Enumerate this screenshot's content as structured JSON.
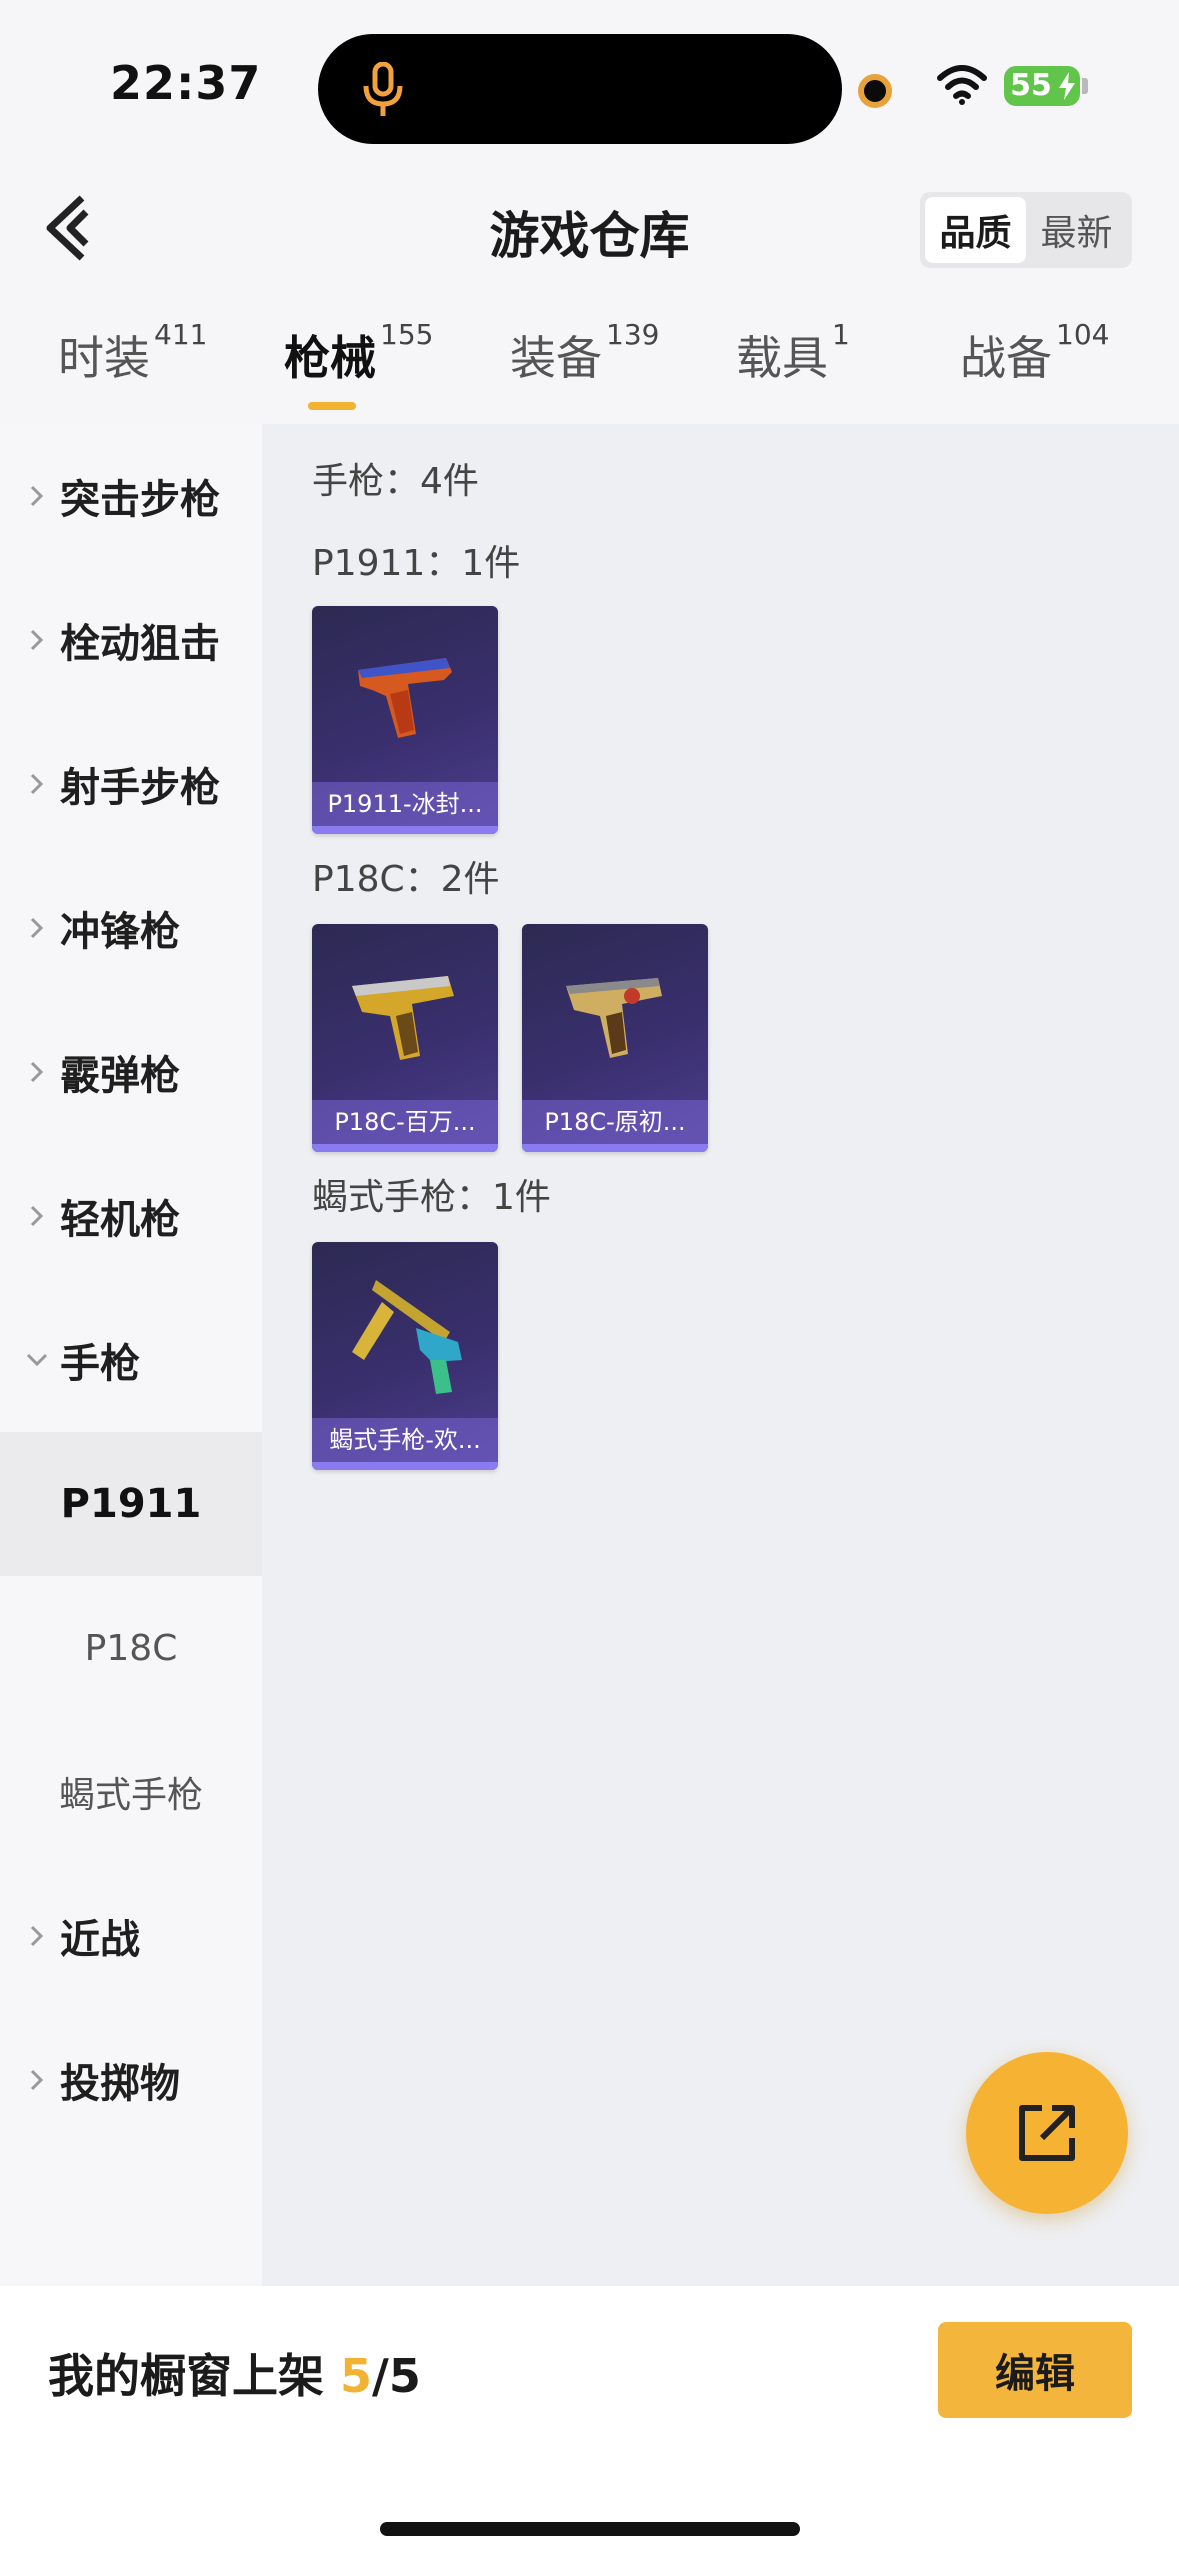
{
  "status_bar": {
    "time": "22:37",
    "battery": "55"
  },
  "header": {
    "title": "游戏仓库",
    "sort_options": [
      "品质",
      "最新"
    ],
    "sort_active": "品质"
  },
  "tabs": [
    {
      "label": "时装",
      "count": "411"
    },
    {
      "label": "枪械",
      "count": "155"
    },
    {
      "label": "装备",
      "count": "139"
    },
    {
      "label": "载具",
      "count": "1"
    },
    {
      "label": "战备",
      "count": "104"
    }
  ],
  "sidebar": {
    "categories": [
      "突击步枪",
      "栓动狙击",
      "射手步枪",
      "冲锋枪",
      "霰弹枪",
      "轻机枪",
      "手枪"
    ],
    "subcategories": [
      "P1911",
      "P18C",
      "蝎式手枪"
    ],
    "categories_after": [
      "近战",
      "投掷物"
    ]
  },
  "content": {
    "section_title": "手枪：4件",
    "groups": [
      {
        "title": "P1911：1件",
        "items": [
          "P1911-冰封..."
        ]
      },
      {
        "title": "P18C：2件",
        "items": [
          "P18C-百万...",
          "P18C-原初..."
        ]
      },
      {
        "title": "蝎式手枪：1件",
        "items": [
          "蝎式手枪-欢..."
        ]
      }
    ]
  },
  "bottom": {
    "shelf_label": "我的橱窗上架",
    "shelf_current": "5",
    "shelf_total": "/5",
    "edit_label": "编辑"
  },
  "colors": {
    "accent": "#f2b233",
    "card_bg": "#3a2f6e"
  }
}
